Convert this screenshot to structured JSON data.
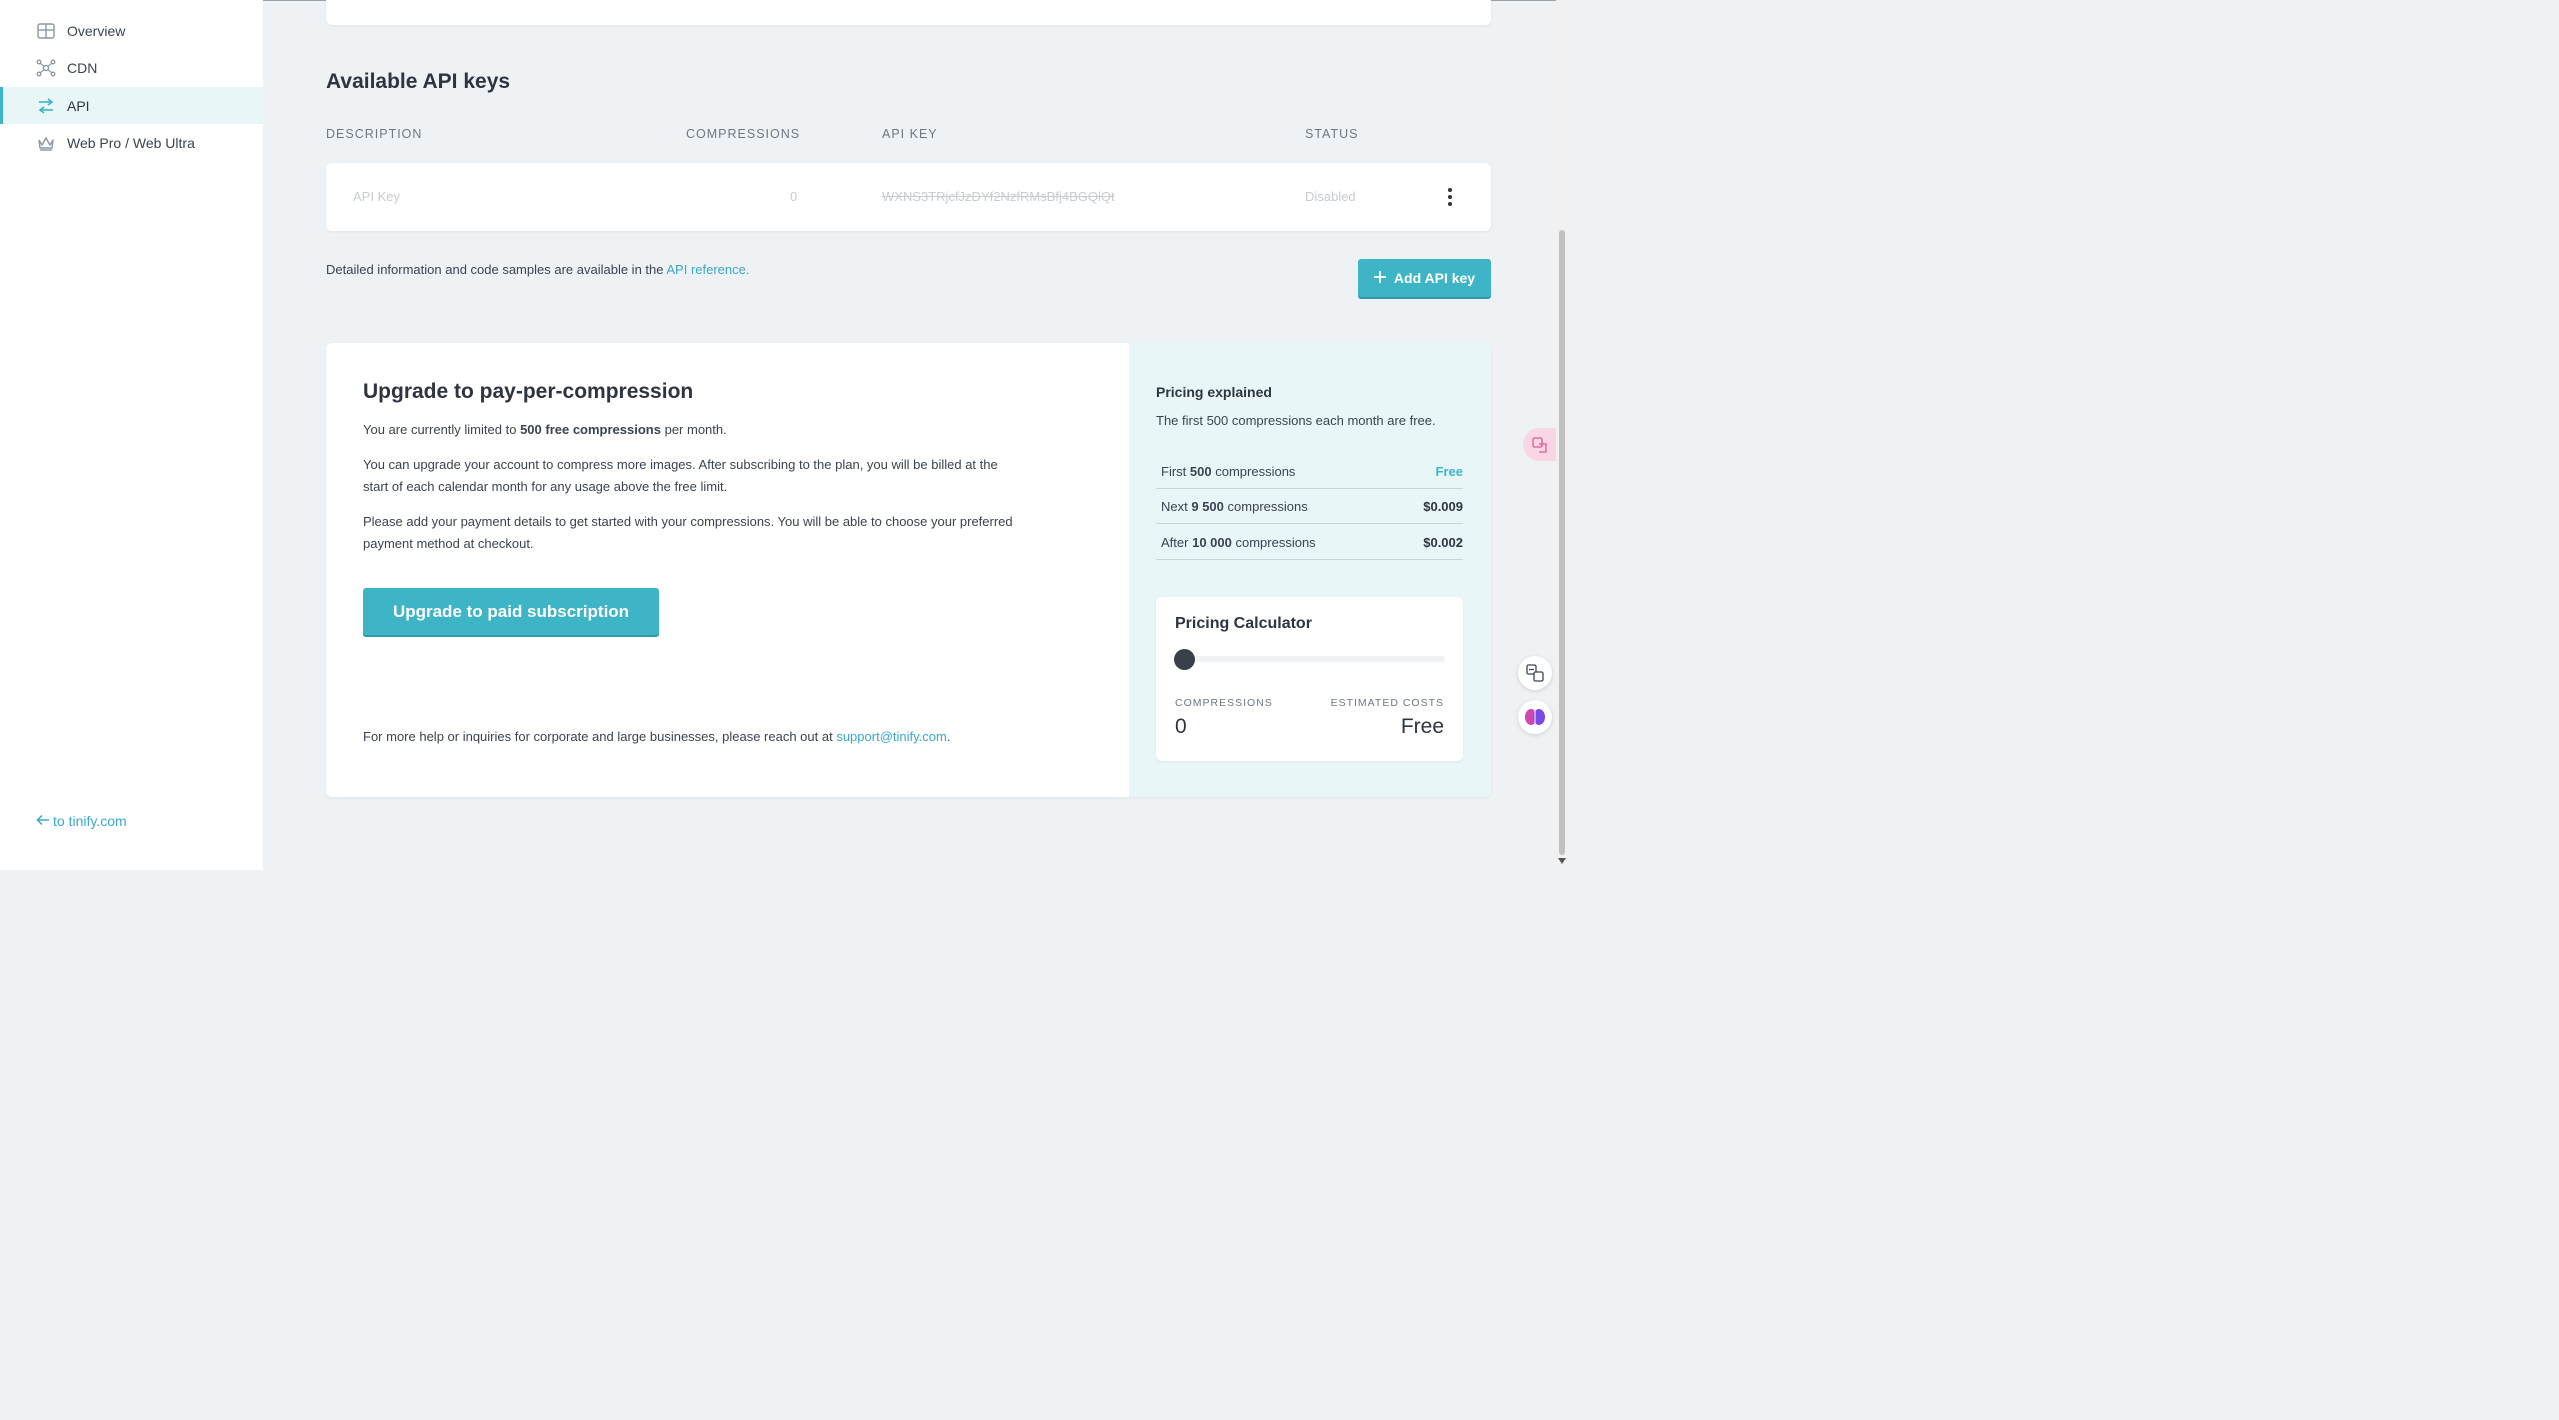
{
  "sidebar": {
    "items": [
      {
        "label": "Overview",
        "icon": "grid-icon"
      },
      {
        "label": "CDN",
        "icon": "network-icon"
      },
      {
        "label": "API",
        "icon": "swap-arrows-icon",
        "active": true
      },
      {
        "label": "Web Pro / Web Ultra",
        "icon": "crown-icon"
      }
    ],
    "back_link": "to tinify.com"
  },
  "api_keys": {
    "title": "Available API keys",
    "columns": [
      "DESCRIPTION",
      "COMPRESSIONS",
      "API KEY",
      "STATUS"
    ],
    "rows": [
      {
        "description": "API Key",
        "compressions": "0",
        "key": "WXNS3TRjcfJzDYf2NzfRMsBfj4BGQlQt",
        "status": "Disabled"
      }
    ],
    "info_text": "Detailed information and code samples are available in the",
    "info_link": "API reference.",
    "add_button": "Add API key"
  },
  "upgrade": {
    "title": "Upgrade to pay-per-compression",
    "limit_prefix": "You are currently limited to",
    "limit_bold": "500 free compressions",
    "limit_suffix": "per month.",
    "paragraph2": "You can upgrade your account to compress more images. After subscribing to the plan, you will be billed at the start of each calendar month for any usage above the free limit.",
    "paragraph3": "Please add your payment details to get started with your compressions. You will be able to choose your preferred payment method at checkout.",
    "button": "Upgrade to paid subscription",
    "help_text": "For more help or inquiries for corporate and large businesses, please reach out at",
    "help_email": "support@tinify.com",
    "help_end": "."
  },
  "pricing": {
    "title": "Pricing explained",
    "subtitle": "The first 500 compressions each month are free.",
    "tiers": [
      {
        "prefix": "First",
        "bold": "500",
        "suffix": "compressions",
        "price": "Free"
      },
      {
        "prefix": "Next",
        "bold": "9 500",
        "suffix": "compressions",
        "price": "$0.009"
      },
      {
        "prefix": "After",
        "bold": "10 000",
        "suffix": "compressions",
        "price": "$0.002"
      }
    ]
  },
  "calculator": {
    "title": "Pricing Calculator",
    "slider_level": 0,
    "compressions_label": "COMPRESSIONS",
    "compressions_value": "0",
    "costs_label": "ESTIMATED COSTS",
    "costs_value": "Free"
  },
  "colors": {
    "accent": "#3db5c6",
    "link": "#3aa8c6",
    "background": "#eff2f5"
  }
}
